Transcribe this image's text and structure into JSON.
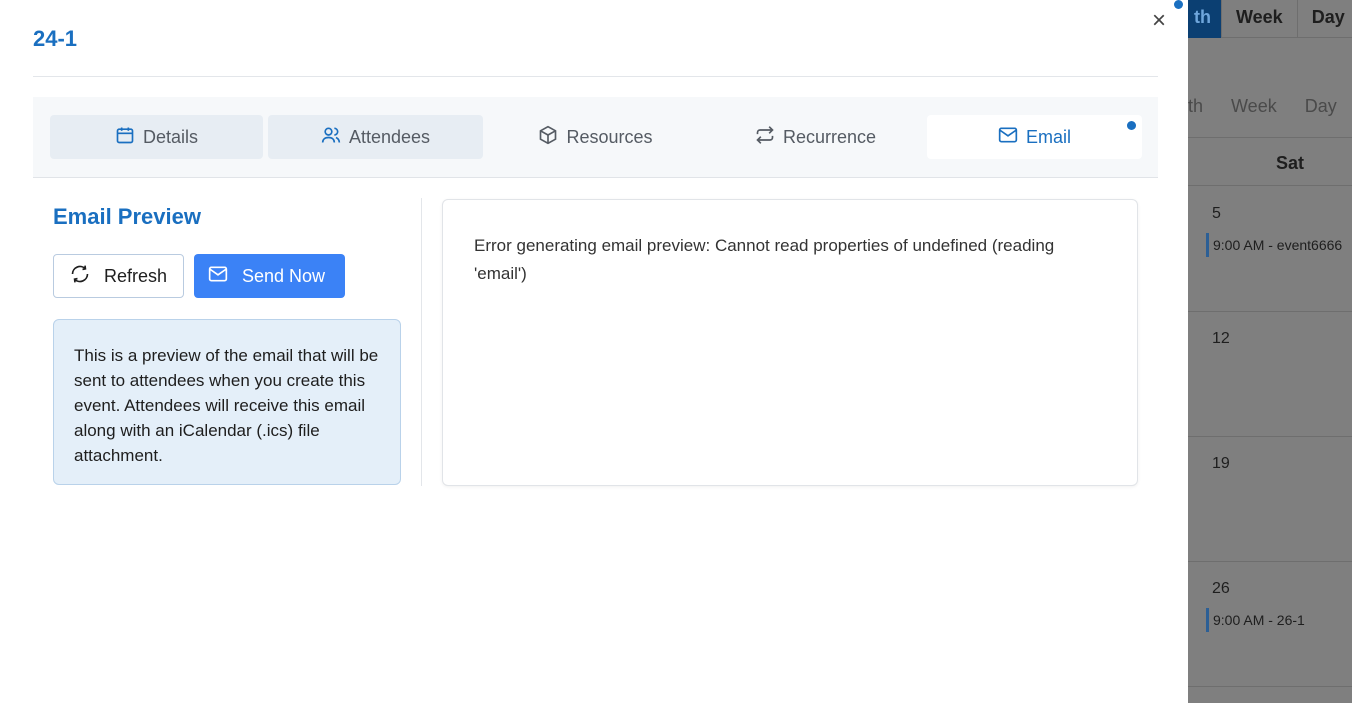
{
  "background_calendar": {
    "view_tabs": [
      "th",
      "Week",
      "Day"
    ],
    "sub_tabs": [
      "th",
      "Week",
      "Day"
    ],
    "day_header": "Sat",
    "cells": [
      {
        "day": "5",
        "event": "9:00 AM - event6666"
      },
      {
        "day": "12",
        "event": ""
      },
      {
        "day": "19",
        "event": ""
      },
      {
        "day": "26",
        "event": "9:00 AM - 26-1"
      }
    ]
  },
  "modal": {
    "title": "24-1",
    "close_glyph": "×",
    "tabs": [
      {
        "label": "Details",
        "icon": "calendar-icon"
      },
      {
        "label": "Attendees",
        "icon": "users-icon"
      },
      {
        "label": "Resources",
        "icon": "box-icon"
      },
      {
        "label": "Recurrence",
        "icon": "repeat-icon"
      },
      {
        "label": "Email",
        "icon": "mail-icon"
      }
    ],
    "active_tab": "Email",
    "email_preview": {
      "heading": "Email Preview",
      "refresh_label": "Refresh",
      "send_label": "Send Now",
      "info_text": "This is a preview of the email that will be sent to attendees when you create this event. Attendees will receive this email along with an iCalendar (.ics) file attachment.",
      "error_text": "Error generating email preview: Cannot read properties of undefined (reading 'email')"
    }
  },
  "colors": {
    "accent": "#1a6fc0",
    "send_button": "#3b82f6",
    "info_bg": "#e4eff9"
  }
}
